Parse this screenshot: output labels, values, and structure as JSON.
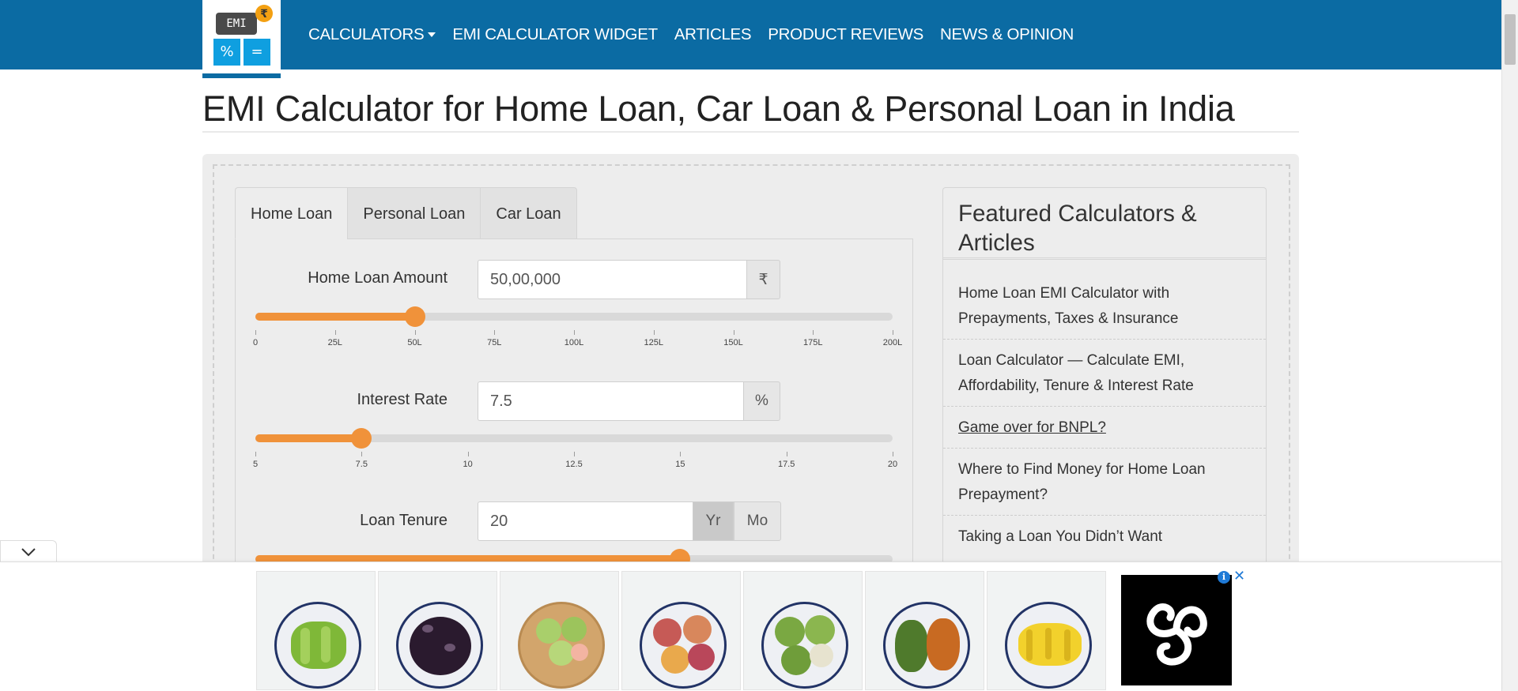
{
  "header": {
    "logo": {
      "screen_text": "EMI",
      "coin_symbol": "₹",
      "key_left": "%",
      "key_right": "="
    },
    "nav": [
      {
        "label": "CALCULATORS",
        "has_dropdown": true
      },
      {
        "label": "EMI CALCULATOR WIDGET"
      },
      {
        "label": "ARTICLES"
      },
      {
        "label": "PRODUCT REVIEWS"
      },
      {
        "label": "NEWS & OPINION"
      }
    ],
    "brand_color": "#0b6ba3"
  },
  "page": {
    "title": "EMI Calculator for Home Loan, Car Loan & Personal Loan in India"
  },
  "calculator": {
    "tabs": [
      {
        "label": "Home Loan",
        "active": true
      },
      {
        "label": "Personal Loan",
        "active": false
      },
      {
        "label": "Car Loan",
        "active": false
      }
    ],
    "accent_color": "#f0923a",
    "amount": {
      "label": "Home Loan Amount",
      "value": "50,00,000",
      "unit": "₹",
      "slider_fraction": 0.25,
      "ticks": [
        "0",
        "25L",
        "50L",
        "75L",
        "100L",
        "125L",
        "150L",
        "175L",
        "200L"
      ]
    },
    "interest": {
      "label": "Interest Rate",
      "value": "7.5",
      "unit": "%",
      "slider_fraction": 0.1667,
      "ticks": [
        "5",
        "7.5",
        "10",
        "12.5",
        "15",
        "17.5",
        "20"
      ]
    },
    "tenure": {
      "label": "Loan Tenure",
      "value": "20",
      "unit_year": "Yr",
      "unit_month": "Mo",
      "selected_unit": "Yr",
      "slider_fraction": 0.6667
    }
  },
  "sidebar": {
    "heading": "Featured Calculators & Articles",
    "items": [
      {
        "label": "Home Loan EMI Calculator with Prepayments, Taxes & Insurance"
      },
      {
        "label": "Loan Calculator — Calculate EMI, Affordability, Tenure & Interest Rate"
      },
      {
        "label": "Game over for BNPL?"
      },
      {
        "label": "Where to Find Money for Home Loan Prepayment?"
      },
      {
        "label": "Taking a Loan You Didn’t Want"
      }
    ]
  },
  "ad": {
    "cards": [
      {
        "icon": "star-fruit-plate"
      },
      {
        "icon": "jamun-plate"
      },
      {
        "icon": "guava-basket"
      },
      {
        "icon": "passion-fruit-plate"
      },
      {
        "icon": "green-guava-plate"
      },
      {
        "icon": "mango-plate"
      },
      {
        "icon": "banana-plate"
      }
    ],
    "info_glyph": "i",
    "close_glyph": "✕"
  }
}
